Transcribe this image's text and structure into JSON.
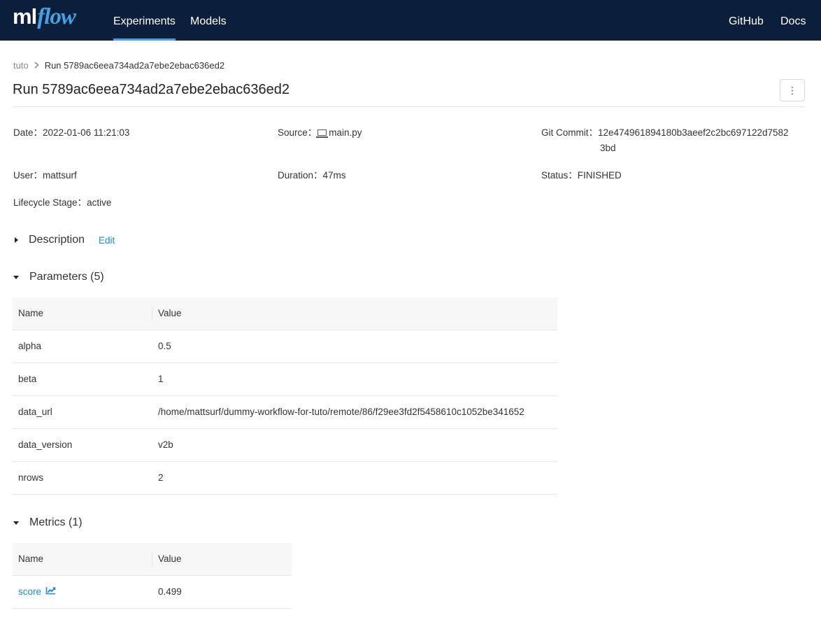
{
  "header": {
    "logo_ml": "ml",
    "logo_flow": "flow",
    "nav": [
      "Experiments",
      "Models"
    ],
    "nav_active": "Experiments",
    "right_links": [
      "GitHub",
      "Docs"
    ],
    "accent_color": "#43a2e6",
    "bar_color": "#0b1f3a"
  },
  "breadcrumb": {
    "parent": "tuto",
    "current": "Run 5789ac6eea734ad2a7ebe2ebac636ed2"
  },
  "title": "Run 5789ac6eea734ad2a7ebe2ebac636ed2",
  "more_icon": "⋮",
  "metadata": {
    "date_label": "Date：",
    "date_value": "2022-01-06 11:21:03",
    "source_label": "Source：",
    "source_value": "main.py",
    "git_label": "Git Commit：",
    "git_value_line1": "12e474961894180b3aeef2c2bc697122d7582",
    "git_value_line2": "3bd",
    "user_label": "User：",
    "user_value": "mattsurf",
    "duration_label": "Duration：",
    "duration_value": "47ms",
    "status_label": "Status：",
    "status_value": "FINISHED",
    "lifecycle_label": "Lifecycle Stage：",
    "lifecycle_value": "active"
  },
  "description": {
    "label": "Description",
    "edit": "Edit"
  },
  "parameters": {
    "label": "Parameters (5)",
    "columns": [
      "Name",
      "Value"
    ],
    "rows": [
      {
        "name": "alpha",
        "value": "0.5"
      },
      {
        "name": "beta",
        "value": "1"
      },
      {
        "name": "data_url",
        "value": "/home/mattsurf/dummy-workflow-for-tuto/remote/86/f29ee3fd2f5458610c1052be341652"
      },
      {
        "name": "data_version",
        "value": "v2b"
      },
      {
        "name": "nrows",
        "value": "2"
      }
    ]
  },
  "metrics": {
    "label": "Metrics (1)",
    "columns": [
      "Name",
      "Value"
    ],
    "rows": [
      {
        "name": "score",
        "value": "0.499",
        "icon": "line-chart-icon"
      }
    ]
  }
}
